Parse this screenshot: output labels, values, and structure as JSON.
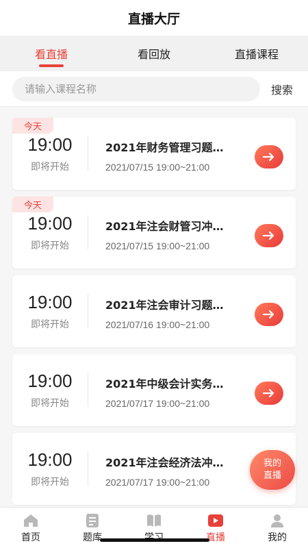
{
  "header": {
    "title": "直播大厅"
  },
  "tabs": [
    {
      "label": "看直播",
      "active": true
    },
    {
      "label": "看回放",
      "active": false
    },
    {
      "label": "直播课程",
      "active": false
    }
  ],
  "search": {
    "placeholder": "请输入课程名称",
    "button_label": "搜索"
  },
  "courses": [
    {
      "badge": "今天",
      "time": "19:00",
      "status": "即将开始",
      "title": "2021年财务管理习题…",
      "date": "2021/07/15 19:00~21:00"
    },
    {
      "badge": "今天",
      "time": "19:00",
      "status": "即将开始",
      "title": "2021年注会财管习冲…",
      "date": "2021/07/15 19:00~21:00"
    },
    {
      "badge": "",
      "time": "19:00",
      "status": "即将开始",
      "title": "2021年注会审计习题…",
      "date": "2021/07/16 19:00~21:00"
    },
    {
      "badge": "",
      "time": "19:00",
      "status": "即将开始",
      "title": "2021年中级会计实务…",
      "date": "2021/07/17 19:00~21:00"
    },
    {
      "badge": "",
      "time": "19:00",
      "status": "即将开始",
      "title": "2021年注会经济法冲…",
      "date": "2021/07/17 19:00~21:00"
    }
  ],
  "fab": {
    "line1": "我的",
    "line2": "直播"
  },
  "tabbar": [
    {
      "label": "首页",
      "icon": "home-icon",
      "active": false
    },
    {
      "label": "题库",
      "icon": "question-bank-icon",
      "active": false
    },
    {
      "label": "学习",
      "icon": "book-icon",
      "active": false
    },
    {
      "label": "直播",
      "icon": "live-play-icon",
      "active": true
    },
    {
      "label": "我的",
      "icon": "profile-icon",
      "active": false
    }
  ],
  "colors": {
    "accent": "#e8413a",
    "inactive_icon": "#b8b8b8"
  }
}
